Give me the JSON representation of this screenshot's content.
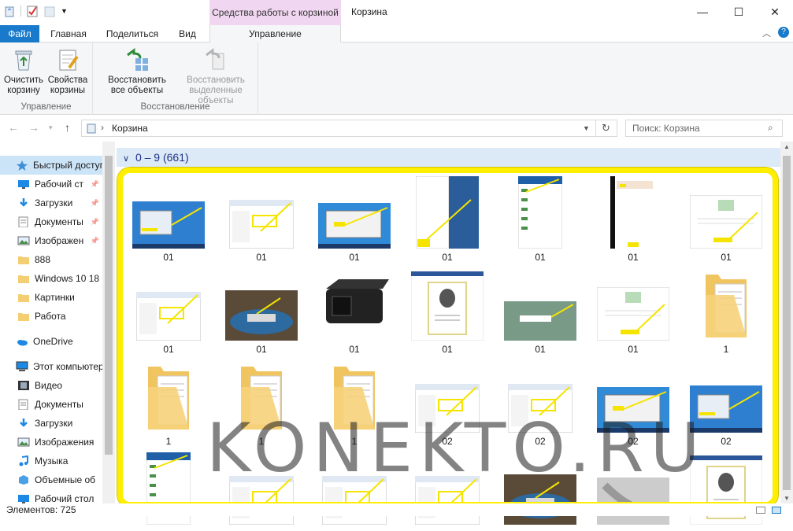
{
  "window": {
    "title": "Корзина",
    "context_tab": "Средства работы с корзиной",
    "minimize": "—",
    "maximize": "☐",
    "close": "✕"
  },
  "tabs": {
    "file": "Файл",
    "home": "Главная",
    "share": "Поделиться",
    "view": "Вид",
    "manage": "Управление"
  },
  "ribbon": {
    "empty_bin": [
      "Очистить",
      "корзину"
    ],
    "bin_props": [
      "Свойства",
      "корзины"
    ],
    "group_manage": "Управление",
    "restore_all": [
      "Восстановить",
      "все объекты"
    ],
    "restore_selected": [
      "Восстановить",
      "выделенные объекты"
    ],
    "group_restore": "Восстановление"
  },
  "address": {
    "path": "Корзина",
    "search_placeholder": "Поиск: Корзина"
  },
  "nav": [
    {
      "label": "Быстрый доступ",
      "icon": "star-icon",
      "pinned": false,
      "selected": true,
      "indent": 0
    },
    {
      "label": "Рабочий ст",
      "icon": "desktop-icon",
      "pinned": true,
      "indent": 1
    },
    {
      "label": "Загрузки",
      "icon": "download-icon",
      "pinned": true,
      "indent": 1
    },
    {
      "label": "Документы",
      "icon": "documents-icon",
      "pinned": true,
      "indent": 1
    },
    {
      "label": "Изображен",
      "icon": "pictures-icon",
      "pinned": true,
      "indent": 1
    },
    {
      "label": "888",
      "icon": "folder-icon",
      "indent": 1
    },
    {
      "label": "Windows 10 18",
      "icon": "folder-icon",
      "indent": 1
    },
    {
      "label": "Картинки",
      "icon": "folder-icon",
      "indent": 1
    },
    {
      "label": "Работа",
      "icon": "folder-icon",
      "indent": 1
    },
    {
      "label": "OneDrive",
      "icon": "onedrive-icon",
      "indent": 0,
      "gap": true
    },
    {
      "label": "Этот компьютер",
      "icon": "pc-icon",
      "indent": 0,
      "gap": true
    },
    {
      "label": "Видео",
      "icon": "video-icon",
      "indent": 1
    },
    {
      "label": "Документы",
      "icon": "documents-icon",
      "indent": 1
    },
    {
      "label": "Загрузки",
      "icon": "download-icon",
      "indent": 1
    },
    {
      "label": "Изображения",
      "icon": "pictures-icon",
      "indent": 1
    },
    {
      "label": "Музыка",
      "icon": "music-icon",
      "indent": 1
    },
    {
      "label": "Объемные об",
      "icon": "3d-objects-icon",
      "indent": 1
    },
    {
      "label": "Рабочий стол",
      "icon": "desktop-icon",
      "indent": 1
    }
  ],
  "group_header": "0 – 9 (661)",
  "items": [
    {
      "label": "01",
      "kind": "win7"
    },
    {
      "label": "01",
      "kind": "window"
    },
    {
      "label": "01",
      "kind": "win7dialog"
    },
    {
      "label": "01",
      "kind": "startmenu"
    },
    {
      "label": "01",
      "kind": "menulist"
    },
    {
      "label": "01",
      "kind": "darkpanel"
    },
    {
      "label": "01",
      "kind": "webpage"
    },
    {
      "label": "01",
      "kind": "window"
    },
    {
      "label": "01",
      "kind": "router"
    },
    {
      "label": "01",
      "kind": "adapter"
    },
    {
      "label": "01",
      "kind": "document"
    },
    {
      "label": "01",
      "kind": "googlepage"
    },
    {
      "label": "01",
      "kind": "webpage"
    },
    {
      "label": "1",
      "kind": "folder"
    },
    {
      "label": "1",
      "kind": "folder"
    },
    {
      "label": "1",
      "kind": "folder"
    },
    {
      "label": "1",
      "kind": "folder"
    },
    {
      "label": "02",
      "kind": "window"
    },
    {
      "label": "02",
      "kind": "window"
    },
    {
      "label": "02",
      "kind": "win7dialog"
    },
    {
      "label": "02",
      "kind": "win7"
    },
    {
      "label": "",
      "kind": "menulist"
    },
    {
      "label": "",
      "kind": "window"
    },
    {
      "label": "",
      "kind": "window"
    },
    {
      "label": "",
      "kind": "window"
    },
    {
      "label": "",
      "kind": "router"
    },
    {
      "label": "",
      "kind": "photo"
    },
    {
      "label": "",
      "kind": "document"
    }
  ],
  "status": "Элементов: 725",
  "watermark": "KONEKTO.RU",
  "colors": {
    "accent": "#1979ca",
    "context": "#f0d6f0",
    "highlight": "#ffee00",
    "group_header": "#dce9f7"
  }
}
